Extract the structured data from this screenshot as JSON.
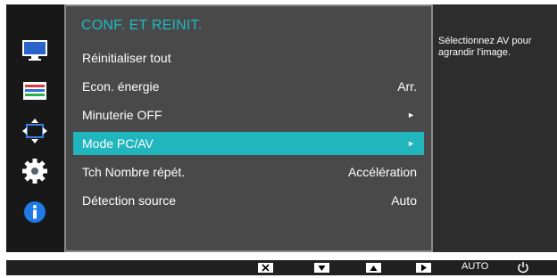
{
  "menu": {
    "title": "CONF. ET REINIT.",
    "items": [
      {
        "label": "Réinitialiser tout",
        "value": ""
      },
      {
        "label": "Econ. énergie",
        "value": "Arr."
      },
      {
        "label": "Minuterie OFF",
        "value": "►"
      },
      {
        "label": "Mode PC/AV",
        "value": "►"
      },
      {
        "label": "Tch Nombre répét.",
        "value": "Accélération"
      },
      {
        "label": "Détection source",
        "value": "Auto"
      }
    ],
    "selected_index": 3
  },
  "help": {
    "text": "Sélectionnez AV pour agrandir l'image."
  },
  "sidebar": {
    "icons": [
      "picture-icon",
      "color-icon",
      "size-position-icon",
      "setup-gear-icon",
      "information-icon"
    ]
  },
  "bottom_bar": {
    "keys": [
      "close-icon",
      "down-icon",
      "up-icon",
      "enter-icon"
    ],
    "auto_label": "AUTO",
    "power_icon": "power-icon"
  },
  "colors": {
    "accent": "#21b5bd",
    "title": "#1fb9c4",
    "background": "#3b3b3b"
  }
}
